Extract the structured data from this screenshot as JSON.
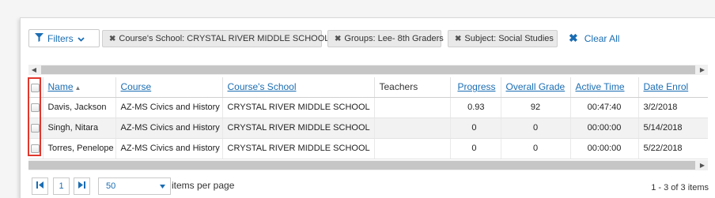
{
  "toolbar": {
    "filters_label": "Filters",
    "chips": [
      {
        "label": "Course's School: CRYSTAL RIVER MIDDLE SCHOOL"
      },
      {
        "label": "Groups: Lee- 8th Graders"
      },
      {
        "label": "Subject: Social Studies"
      }
    ],
    "clear_all_label": "Clear All"
  },
  "grid": {
    "columns": [
      "Name",
      "Course",
      "Course's School",
      "Teachers",
      "Progress",
      "Overall Grade",
      "Active Time",
      "Date Enrol"
    ],
    "sort_column": "Name",
    "rows": [
      {
        "name": "Davis, Jackson",
        "course": "AZ-MS Civics and History",
        "school": "CRYSTAL RIVER MIDDLE SCHOOL",
        "teachers": "",
        "progress": "0.93",
        "grade": "92",
        "active_time": "00:47:40",
        "date": "3/2/2018"
      },
      {
        "name": "Singh, Nitara",
        "course": "AZ-MS Civics and History",
        "school": "CRYSTAL RIVER MIDDLE SCHOOL",
        "teachers": "",
        "progress": "0",
        "grade": "0",
        "active_time": "00:00:00",
        "date": "5/14/2018"
      },
      {
        "name": "Torres, Penelope",
        "course": "AZ-MS Civics and History",
        "school": "CRYSTAL RIVER MIDDLE SCHOOL",
        "teachers": "",
        "progress": "0",
        "grade": "0",
        "active_time": "00:00:00",
        "date": "5/22/2018"
      }
    ]
  },
  "pager": {
    "current_page": "1",
    "page_size": "50",
    "page_size_label": "items per page",
    "range_text": "1 - 3 of 3 items"
  },
  "colors": {
    "link": "#1a6db3",
    "highlight_border": "#e0382e",
    "chip_bg": "#e9e9e9"
  },
  "icons": {
    "filter": "funnel-icon",
    "clear": "close-icon",
    "sort": "sort-ascending-icon"
  }
}
